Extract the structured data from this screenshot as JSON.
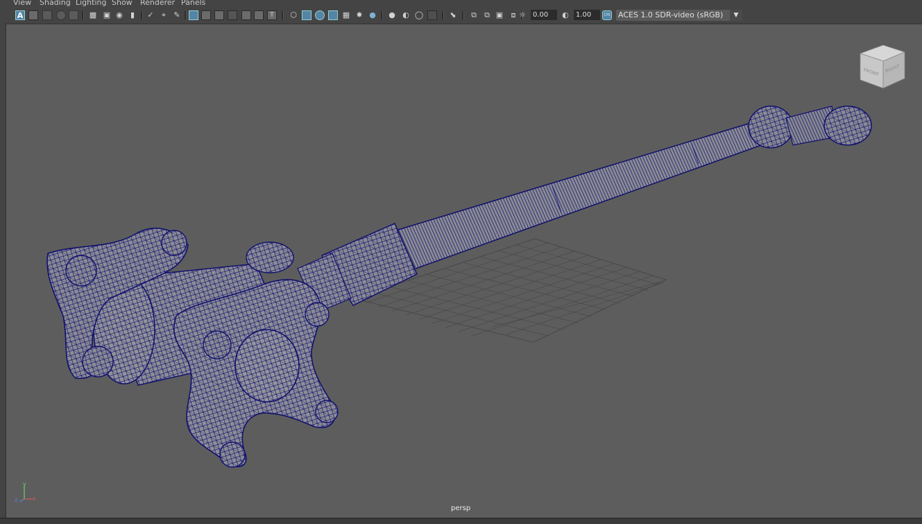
{
  "menu": {
    "view": "View",
    "shading": "Shading",
    "lighting": "Lighting",
    "show": "Show",
    "renderer": "Renderer",
    "panels": "Panels"
  },
  "toolbar": {
    "exposure_value": "0.00",
    "gamma_value": "1.00",
    "color_management_badge": "ON",
    "color_space": "ACES 1.0 SDR-video (sRGB)",
    "select_mode_glyph": "A"
  },
  "viewcube": {
    "front_label": "FRONT",
    "right_label": "RIGHT"
  },
  "axis": {
    "x": "x",
    "y": "y",
    "z": "z"
  },
  "viewport": {
    "camera_name": "persp",
    "background_color": "#5d5d5d",
    "wire_color": "#1a1a80",
    "shade_color": "#8e8e94"
  }
}
